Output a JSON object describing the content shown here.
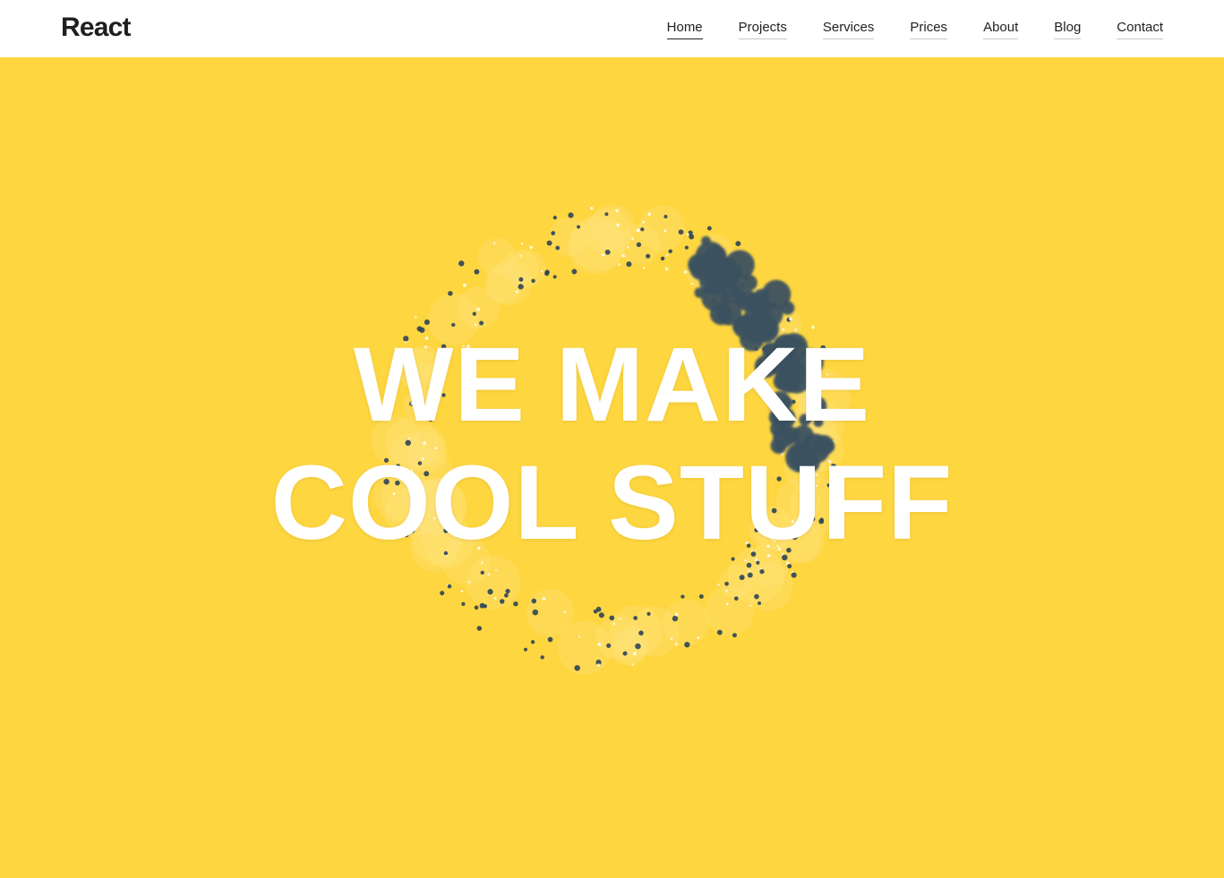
{
  "header": {
    "logo": "React",
    "nav": [
      {
        "label": "Home",
        "active": true
      },
      {
        "label": "Projects",
        "active": false
      },
      {
        "label": "Services",
        "active": false
      },
      {
        "label": "Prices",
        "active": false
      },
      {
        "label": "About",
        "active": false
      },
      {
        "label": "Blog",
        "active": false
      },
      {
        "label": "Contact",
        "active": false
      }
    ]
  },
  "hero": {
    "line1": "WE MAKE",
    "line2": "COOL STUFF"
  },
  "colors": {
    "background": "#fed640",
    "header": "#ffffff",
    "particle_dark": "#2f4459",
    "particle_blob": "#3b5160",
    "text": "#ffffff"
  }
}
